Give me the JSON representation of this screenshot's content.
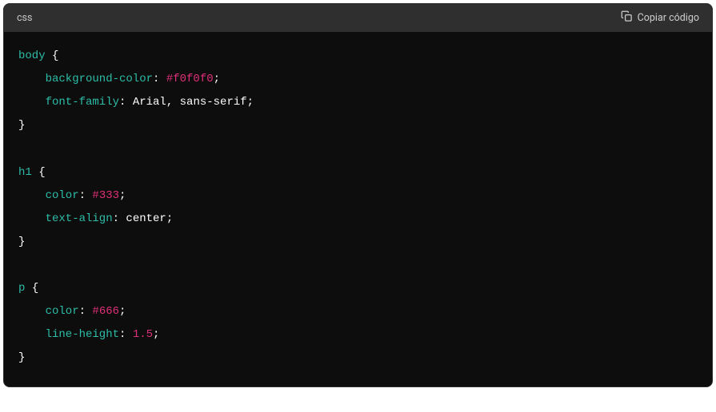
{
  "header": {
    "language": "css",
    "copy_label": "Copiar código"
  },
  "code": {
    "rules": [
      {
        "selector": "body",
        "decls": [
          {
            "prop": "background-color",
            "valueType": "hex",
            "value": "#f0f0f0"
          },
          {
            "prop": "font-family",
            "valueType": "plain",
            "value": "Arial, sans-serif"
          }
        ]
      },
      {
        "selector": "h1",
        "decls": [
          {
            "prop": "color",
            "valueType": "hex",
            "value": "#333"
          },
          {
            "prop": "text-align",
            "valueType": "plain",
            "value": "center"
          }
        ]
      },
      {
        "selector": "p",
        "decls": [
          {
            "prop": "color",
            "valueType": "hex",
            "value": "#666"
          },
          {
            "prop": "line-height",
            "valueType": "num",
            "value": "1.5"
          }
        ]
      }
    ]
  }
}
